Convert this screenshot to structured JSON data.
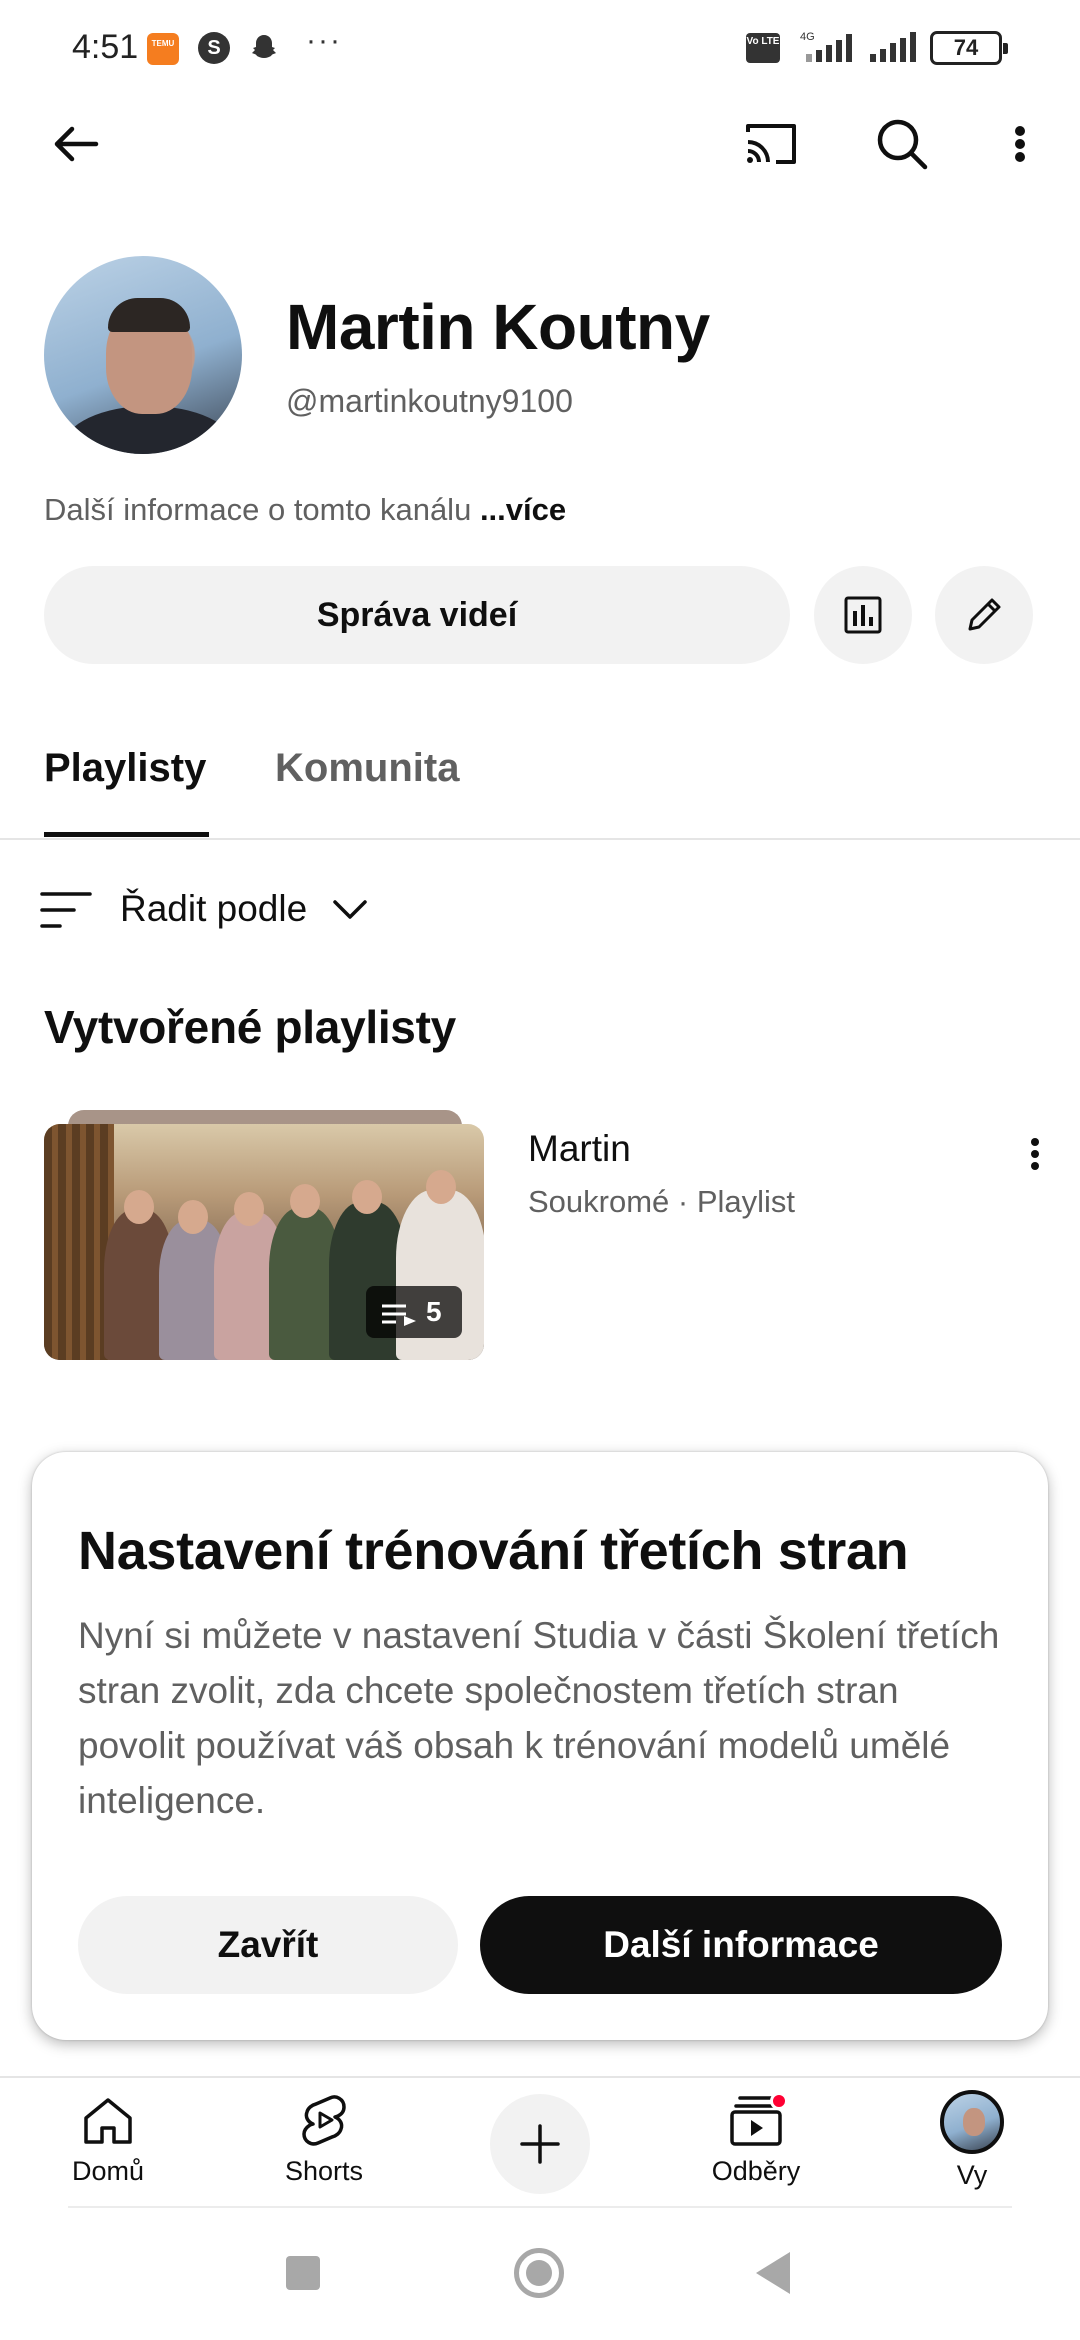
{
  "status_bar": {
    "time": "4:51",
    "notification_icons": [
      "temu-icon",
      "s-app-icon",
      "snapchat-icon"
    ],
    "overflow": "···",
    "network": "4G",
    "volte": "Vo LTE",
    "battery": "74"
  },
  "toolbar": {
    "icons": [
      "back-arrow-icon",
      "cast-icon",
      "search-icon",
      "more-vert-icon"
    ]
  },
  "channel": {
    "name": "Martin Koutny",
    "handle": "@martinkoutny9100",
    "about": "Další informace o tomto kanálu",
    "about_more": "...více",
    "manage_label": "Správa videí"
  },
  "tabs": [
    {
      "label": "Playlisty",
      "active": true
    },
    {
      "label": "Komunita",
      "active": false
    }
  ],
  "sort": {
    "label": "Řadit podle"
  },
  "section_title": "Vytvořené playlisty",
  "playlists": [
    {
      "title": "Martin",
      "meta": "Soukromé · Playlist",
      "count": "5"
    }
  ],
  "dialog": {
    "title": "Nastavení trénování třetích stran",
    "body": "Nyní si můžete v nastavení Studia v části Školení třetích stran zvolit, zda chcete společnostem třetích stran povolit používat váš obsah k trénování modelů umělé inteligence.",
    "close_label": "Zavřít",
    "info_label": "Další informace"
  },
  "bottom_nav": {
    "home": "Domů",
    "shorts": "Shorts",
    "subscriptions": "Odběry",
    "you": "Vy"
  },
  "colors": {
    "text_primary": "#0f0f0f",
    "text_secondary": "#606060",
    "chip_bg": "#f2f2f2",
    "notification_dot": "#ff0033"
  }
}
